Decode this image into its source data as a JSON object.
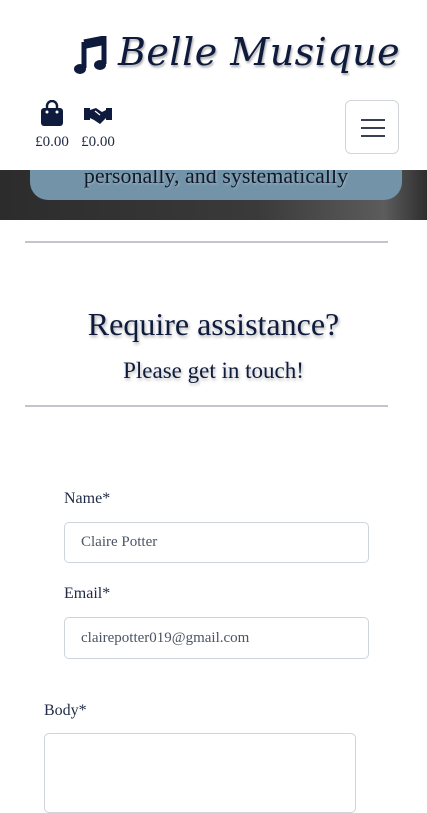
{
  "brand": {
    "title": "Belle Musique",
    "logo_icon": "music-note-icon"
  },
  "header": {
    "bag": {
      "icon": "shopping-bag-icon",
      "amount": "£0.00"
    },
    "donate": {
      "icon": "handshake-icon",
      "amount": "£0.00"
    },
    "menu_icon": "hamburger-menu-icon"
  },
  "hero": {
    "text": "personally, and systematically"
  },
  "contact": {
    "heading": "Require assistance?",
    "subheading": "Please get in touch!",
    "name_label": "Name*",
    "name_value": "Claire Potter",
    "email_label": "Email*",
    "email_value": "clairepotter019@gmail.com",
    "body_label": "Body*",
    "body_value": ""
  },
  "colors": {
    "brand": "#0f1b3d",
    "banner": "#7293a8"
  }
}
